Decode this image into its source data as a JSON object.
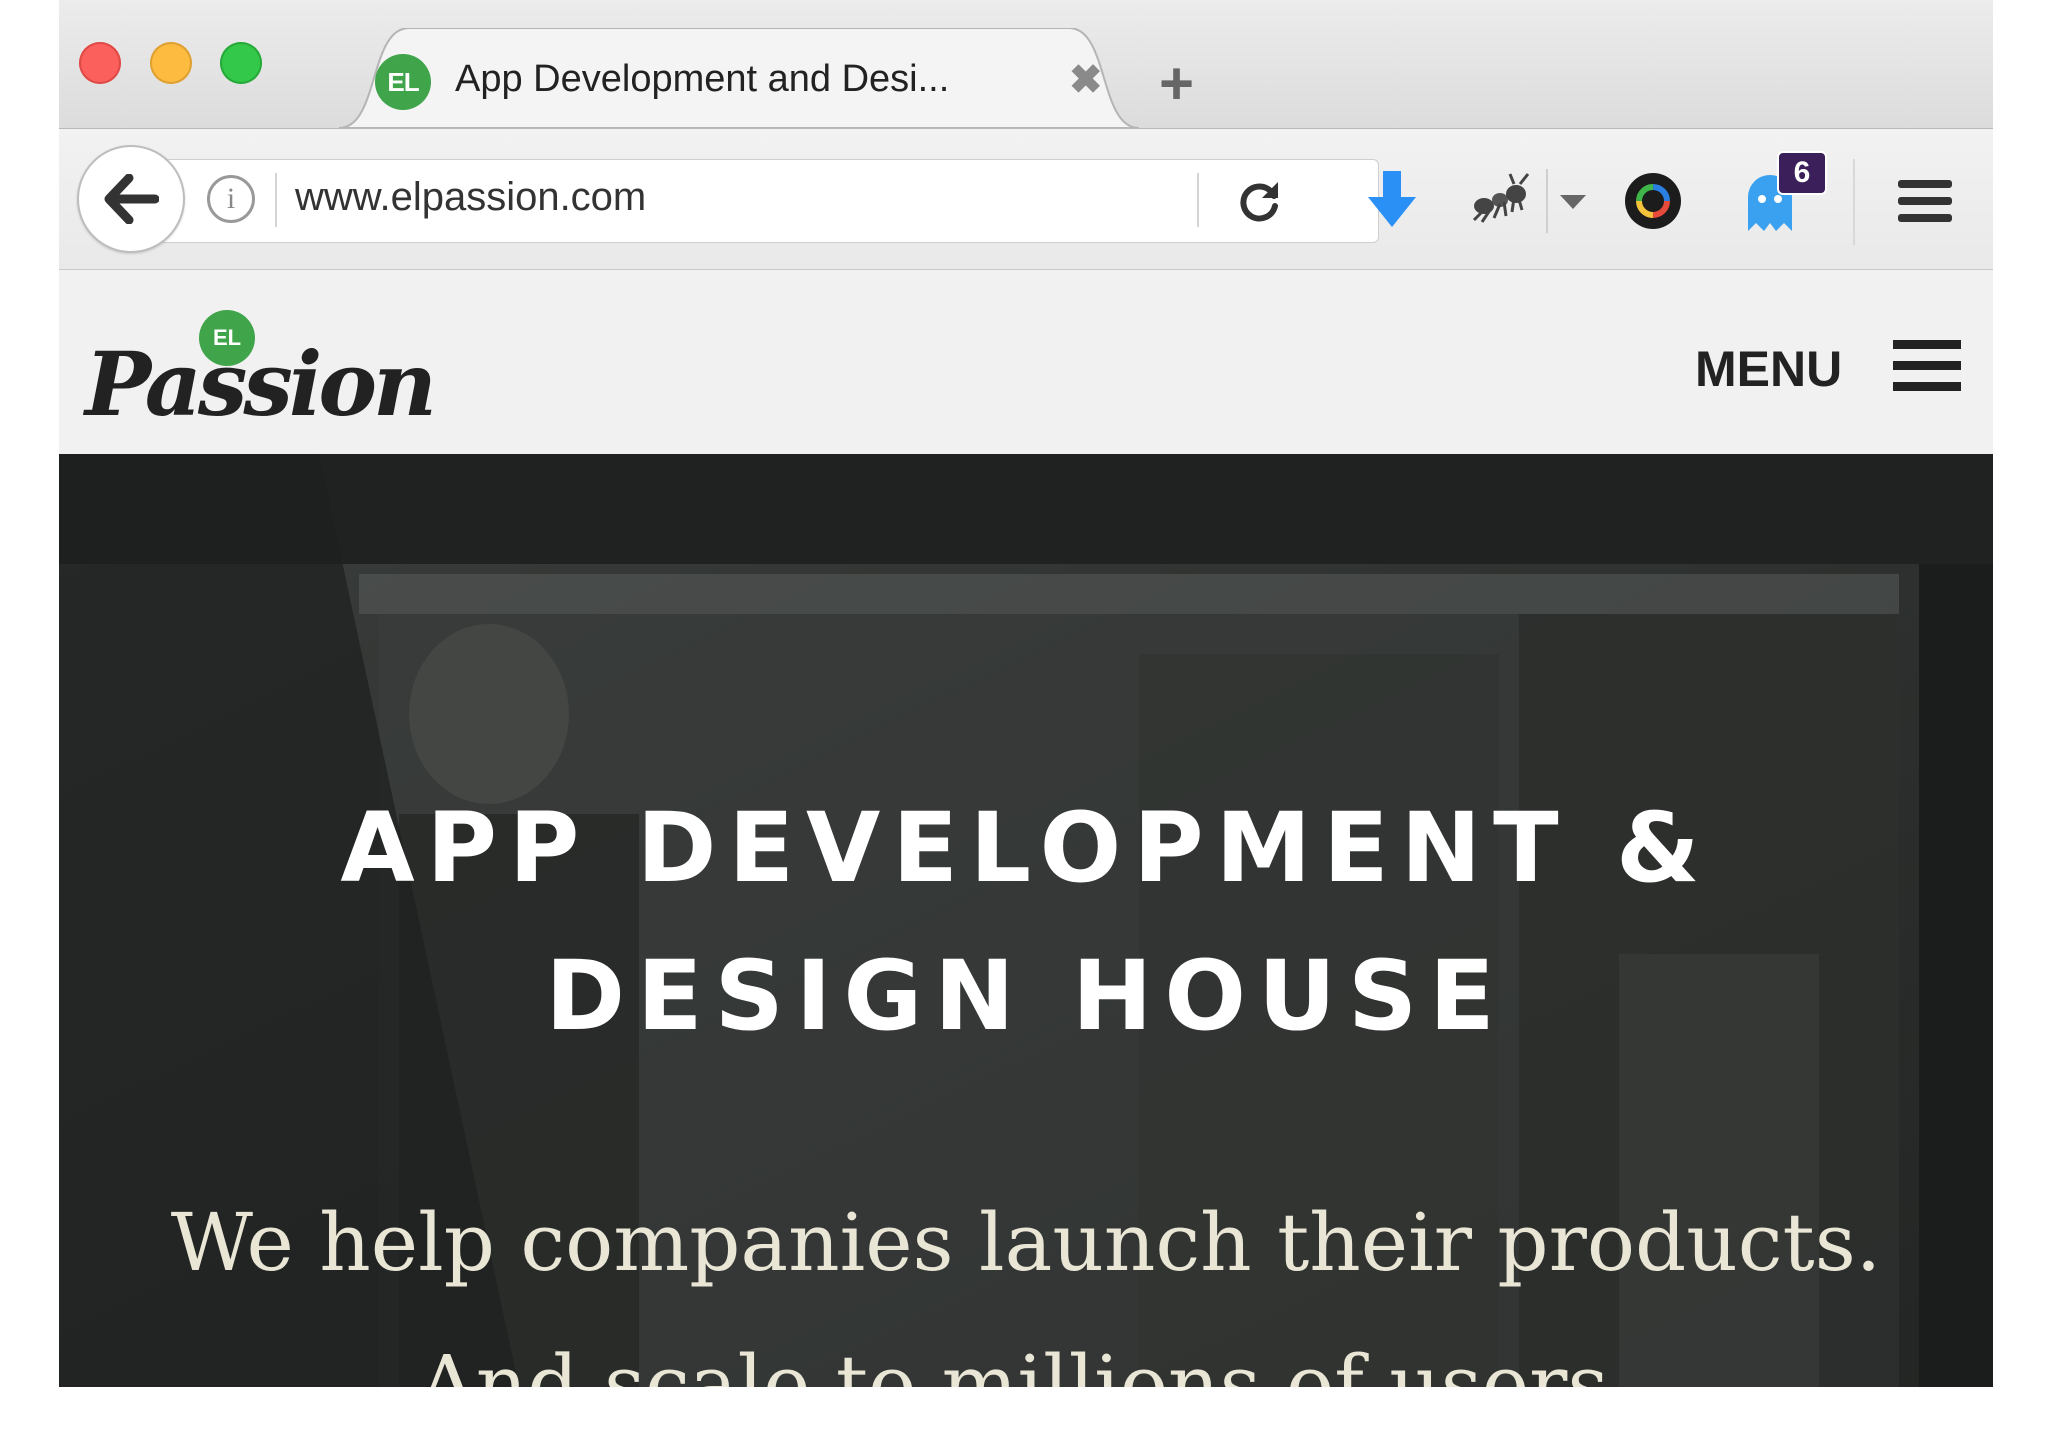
{
  "browser": {
    "tab": {
      "favicon_text": "EL",
      "title": "App Development and Desi...",
      "close_glyph": "✖"
    },
    "new_tab_glyph": "+",
    "url": "www.elpassion.com",
    "info_glyph": "i",
    "badge_count": "6",
    "colors": {
      "download_blue": "#2a90f5",
      "ghost_blue": "#3aa0f0",
      "badge_purple": "#3a1f5a"
    }
  },
  "site": {
    "logo_badge": "EL",
    "logo_text": "Passion",
    "menu_label": "MENU",
    "hero": {
      "title_line1": "APP DEVELOPMENT &",
      "title_line2": "DESIGN HOUSE",
      "sub_line1": "We help companies launch their products.",
      "sub_line2": "And scale to millions of users."
    },
    "colors": {
      "brand_green": "#3fa44a",
      "header_bg": "#f1f1f1",
      "hero_text": "#ffffff",
      "hero_sub": "#e9e6d6"
    }
  }
}
